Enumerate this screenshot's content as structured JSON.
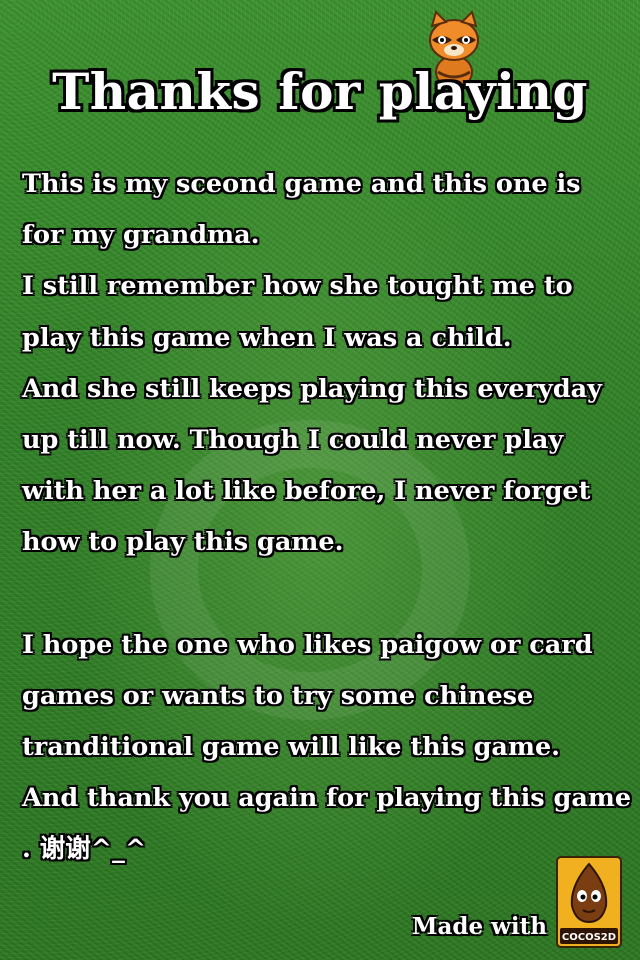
{
  "screen": {
    "title": "Thanks for playing",
    "paragraph_lines": [
      "This is my sceond game and this one is",
      "for my grandma.",
      "I still remember how she tought me to",
      "play this game when I was a child.",
      "And she still keeps playing this everyday",
      "up till now. Though I could never play",
      "with her a lot like before, I never forget",
      "how to play this game.",
      "",
      "I hope the one who likes paigow or card",
      "games or wants to try some chinese",
      "tranditional game will like this game.",
      "And thank you again for playing this game",
      ". 谢谢^_^"
    ],
    "made_with_label": "Made with",
    "engine_logo_text": "COCOS2D",
    "mascot_icon": "raccoon-icon",
    "engine_icon": "cocos2d-coconut-icon"
  },
  "colors": {
    "background": "#2f7e25",
    "text": "#ffffff",
    "text_outline": "#000000",
    "logo_bg": "#f0b020"
  }
}
